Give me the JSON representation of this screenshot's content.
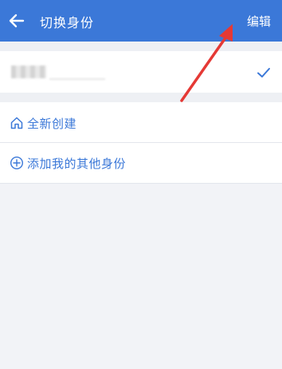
{
  "header": {
    "title": "切换身份",
    "edit_label": "编辑",
    "back_icon": "arrow-left-icon",
    "bg_color": "#3b78d8"
  },
  "identities": [
    {
      "selected": true,
      "check_icon": "checkmark-icon"
    }
  ],
  "actions": {
    "create_new_label": "全新创建",
    "create_new_icon": "house-outline-icon",
    "add_other_label": "添加我的其他身份",
    "add_other_icon": "plus-circle-icon"
  },
  "colors": {
    "accent": "#3b78d8",
    "annotation_arrow": "#e53935"
  }
}
